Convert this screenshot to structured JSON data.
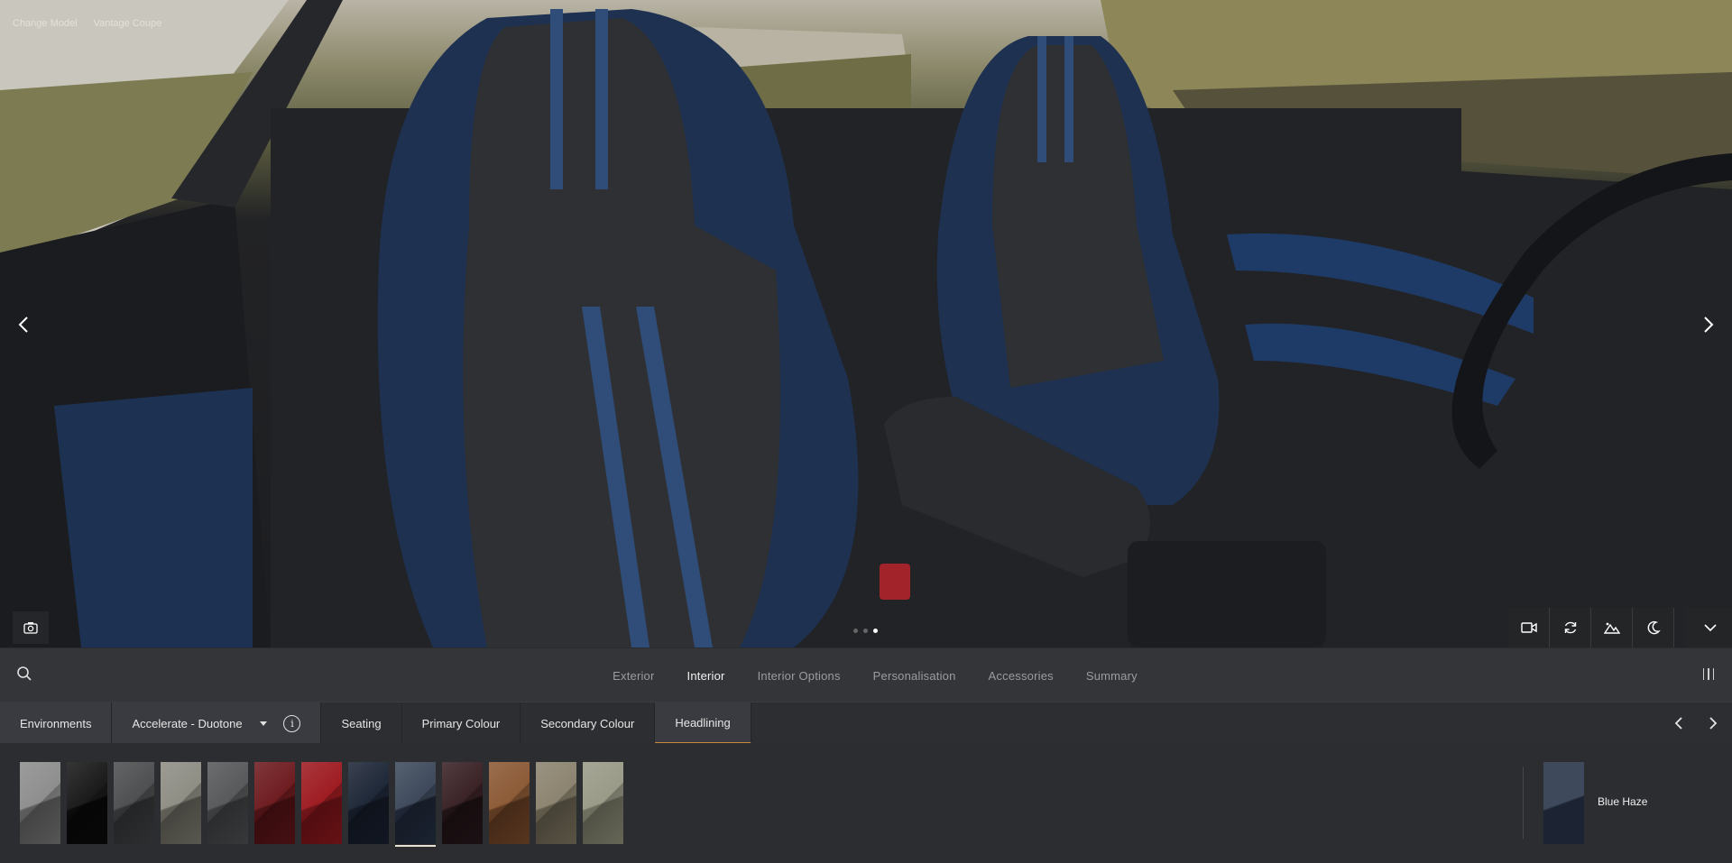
{
  "breadcrumb": {
    "change_model": "Change Model",
    "model": "Vantage Coupe"
  },
  "viewport": {
    "prev_icon": "chevron-left-icon",
    "next_icon": "chevron-right-icon",
    "camera_icon": "camera-icon",
    "carousel_dots": 3,
    "carousel_active": 2,
    "tools": [
      "video-camera-icon",
      "rotate-icon",
      "landscape-icon",
      "moon-icon",
      "chevron-down-icon"
    ]
  },
  "nav": {
    "search_icon": "search-icon",
    "tabs": [
      "Exterior",
      "Interior",
      "Interior Options",
      "Personalisation",
      "Accessories",
      "Summary"
    ],
    "active_tab": "Interior",
    "menu_icon": "vertical-bars-menu-icon"
  },
  "subnav": {
    "environments": "Environments",
    "theme": "Accelerate - Duotone",
    "info_icon": "info-icon",
    "items": [
      "Seating",
      "Primary Colour",
      "Secondary Colour",
      "Headlining"
    ],
    "active_item": "Headlining"
  },
  "swatches": [
    {
      "top": "#8e8e8e",
      "bottom": "#5a5a5a"
    },
    {
      "top": "#1a1a1a",
      "bottom": "#080808"
    },
    {
      "top": "#4e4f50",
      "bottom": "#303132"
    },
    {
      "top": "#8f8e85",
      "bottom": "#5d5c54"
    },
    {
      "top": "#58595a",
      "bottom": "#3a3b3c"
    },
    {
      "top": "#6e1c20",
      "bottom": "#4a1013"
    },
    {
      "top": "#9e1c22",
      "bottom": "#6c1216"
    },
    {
      "top": "#1f2838",
      "bottom": "#121824"
    },
    {
      "top": "#3e4a5c",
      "bottom": "#1c2433"
    },
    {
      "top": "#3a2226",
      "bottom": "#1d1114"
    },
    {
      "top": "#8c5a36",
      "bottom": "#5c3820"
    },
    {
      "top": "#8c8470",
      "bottom": "#5e5848"
    },
    {
      "top": "#9a9a88",
      "bottom": "#6c6c5c"
    }
  ],
  "selected_index": 8,
  "selected": {
    "name": "Blue Haze",
    "top": "#3e4a5c",
    "bottom": "#1c2433"
  }
}
